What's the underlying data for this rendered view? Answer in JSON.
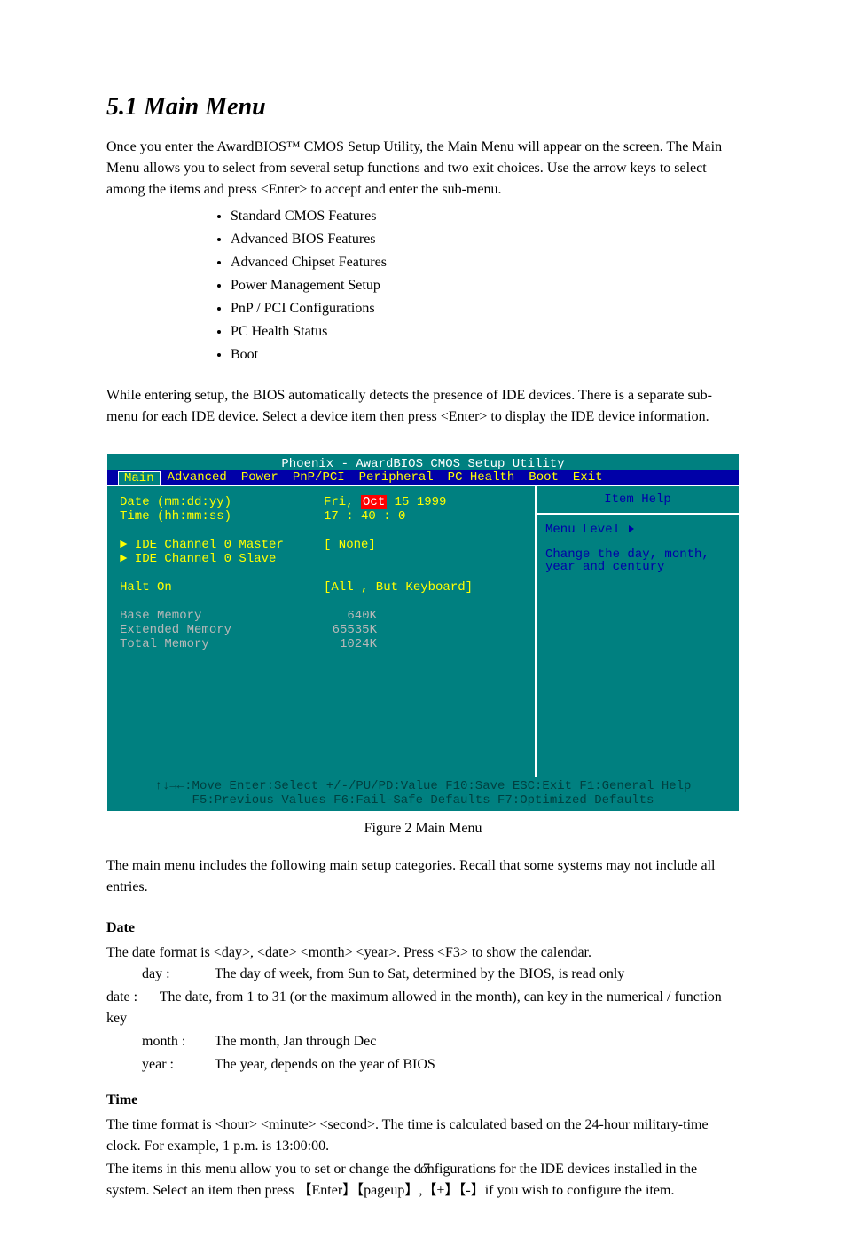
{
  "section_title": "5.1 Main Menu",
  "intro": "Once you enter the AwardBIOS™ CMOS Setup Utility, the Main Menu will appear on the screen. The Main Menu allows you to select from several setup functions and two exit choices. Use the arrow keys to select among the items and press <Enter> to accept and enter the sub-menu.",
  "bullets": [
    "Standard CMOS Features",
    "Advanced BIOS Features",
    "Advanced Chipset Features",
    "Power Management Setup",
    "PnP / PCI Configurations",
    "PC Health Status",
    "Boot"
  ],
  "subfunc_text": "While entering setup, the BIOS automatically detects the presence of IDE devices. There is a separate sub-menu for each IDE device. Select a device item then press <Enter> to display the IDE device information.",
  "bios": {
    "title": "Phoenix - AwardBIOS CMOS Setup Utility",
    "tabs": [
      "Main",
      "Advanced",
      "Power",
      "PnP/PCI",
      "Peripheral",
      "PC Health",
      "Boot",
      "Exit"
    ],
    "selected_tab": "Main",
    "rows": {
      "date_label": "Date (mm:dd:yy)",
      "date_val_prefix": "Fri, ",
      "date_sel": "Oct",
      "date_val_suffix": " 15 1999",
      "time_label": "Time (hh:mm:ss)",
      "time_val": "17 : 40 :  0",
      "ide0m": "IDE Channel 0 Master",
      "ide0m_val": "[ None]",
      "ide0s": "IDE Channel 0 Slave",
      "halt_label": "Halt On",
      "halt_val": "[All , But Keyboard]",
      "base_label": "Base Memory",
      "base_val": "640K",
      "ext_label": "Extended Memory",
      "ext_val": "65535K",
      "total_label": "Total Memory",
      "total_val": "1024K"
    },
    "help": {
      "title": "Item Help",
      "menu_level": "Menu Level",
      "text": "Change the day, month, year and century"
    },
    "footer": {
      "line1": "↑↓→←:Move  Enter:Select  +/-/PU/PD:Value  F10:Save  ESC:Exit  F1:General Help",
      "line2": "F5:Previous Values    F6:Fail-Safe Defaults    F7:Optimized Defaults"
    }
  },
  "figure_label": "Figure 2 Main Menu",
  "desc": "The main menu includes the following main setup categories. Recall that some systems may not include all entries.",
  "date_title": "Date",
  "date_text": "The date format is <day>, <date> <month> <year>. Press <F3> to show the calendar.",
  "date_fields": {
    "day_label": "day",
    "day_text": "The day of week, from Sun to Sat, determined by the BIOS, is read only",
    "date_label": "date",
    "date_text": "The date, from 1 to 31 (or the maximum allowed in the month), can key in the numerical / function key",
    "month_label": "month",
    "month_text": "The month, Jan through Dec",
    "year_label": "year",
    "year_text": "The year, depends on the year of BIOS"
  },
  "time_title": "Time",
  "time_text_1": "The time format is <hour> <minute> <second>. The time is calculated based on the 24-hour military-time clock. For example, 1 p.m. is 13:00:00.",
  "time_text_2": "The items in this menu allow you to set or change the configurations for the IDE devices installed in the system. Select an item then press 【Enter】【pageup】,【+】【-】if you wish to configure the item.",
  "page_num": "- 17 -"
}
